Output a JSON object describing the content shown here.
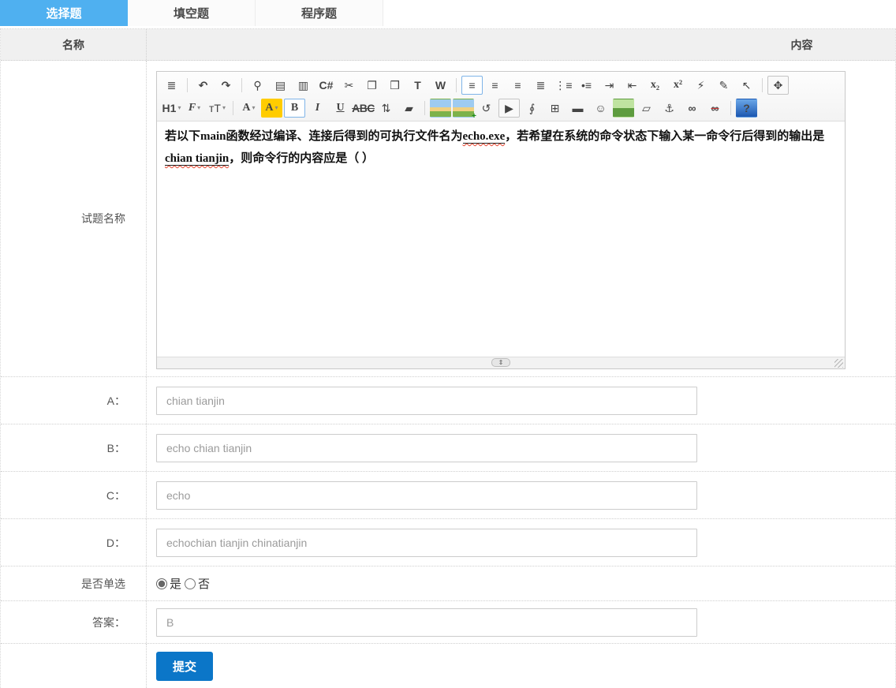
{
  "colors": {
    "accent_tab_blue": "#4FB0F0",
    "submit_button_blue": "#0B76C8",
    "toolbar_icon_blue": "#2b65c0",
    "highlight_yellow": "#FFCC00",
    "spellcheck_red": "#e8442e"
  },
  "tabs": [
    {
      "label": "选择题",
      "active": true
    },
    {
      "label": "填空题",
      "active": false
    },
    {
      "label": "程序题",
      "active": false
    }
  ],
  "table": {
    "header": {
      "name": "名称",
      "content": "内容"
    }
  },
  "question": {
    "label": "试题名称"
  },
  "editor": {
    "statusbar_handle": "⇕",
    "content_segments": [
      {
        "text": "若以下main函数经过编译、连接后得到的可执行文件名为",
        "cls": "seg"
      },
      {
        "text": "echo.exe",
        "cls": "seg uw"
      },
      {
        "text": "，若希望在系统的命令状态下输入某一命令行后得到的输出是",
        "cls": "seg"
      },
      {
        "text": "chian tianjin",
        "cls": "seg uw"
      },
      {
        "text": "，则命令行的内容应是（ ）",
        "cls": "seg"
      }
    ],
    "toolbar": {
      "row1": [
        {
          "n": "source-icon",
          "g": "≣",
          "cls": "ic c-dark",
          "i": "true"
        },
        {
          "n": "separator",
          "g": "",
          "cls": "sep",
          "i": "false"
        },
        {
          "n": "undo-icon",
          "g": "↶",
          "cls": "ic c-blue bld",
          "i": "true"
        },
        {
          "n": "redo-icon",
          "g": "↷",
          "cls": "ic c-blue bld",
          "i": "true"
        },
        {
          "n": "separator",
          "g": "",
          "cls": "sep",
          "i": "false"
        },
        {
          "n": "preview-icon",
          "g": "⚲",
          "cls": "ic c-gray",
          "i": "true"
        },
        {
          "n": "print-icon",
          "g": "▤",
          "cls": "ic c-gray",
          "i": "true"
        },
        {
          "n": "template-icon",
          "g": "▥",
          "cls": "ic c-orange",
          "i": "true"
        },
        {
          "n": "code-icon",
          "g": "C#",
          "cls": "ic c-slate sm bld",
          "i": "true"
        },
        {
          "n": "cut-icon",
          "g": "✂",
          "cls": "ic c-dark",
          "i": "true"
        },
        {
          "n": "copy-icon",
          "g": "❐",
          "cls": "ic c-blue",
          "i": "true"
        },
        {
          "n": "paste-icon",
          "g": "❒",
          "cls": "ic c-tan",
          "i": "true"
        },
        {
          "n": "paste-as-text-icon",
          "g": "T",
          "cls": "ic c-navy bld sm",
          "i": "true"
        },
        {
          "n": "paste-from-word-icon",
          "g": "W",
          "cls": "ic c-navy bld sm",
          "i": "true"
        },
        {
          "n": "separator",
          "g": "",
          "cls": "sep",
          "i": "false"
        },
        {
          "n": "align-left-icon",
          "g": "≡",
          "cls": "ic c-dark sel",
          "i": "true"
        },
        {
          "n": "align-center-icon",
          "g": "≡",
          "cls": "ic c-dark",
          "i": "true"
        },
        {
          "n": "align-right-icon",
          "g": "≡",
          "cls": "ic c-dark",
          "i": "true"
        },
        {
          "n": "align-justify-icon",
          "g": "≣",
          "cls": "ic c-dark",
          "i": "true"
        },
        {
          "n": "ordered-list-icon",
          "g": "⋮≡",
          "cls": "ic c-dark sm",
          "i": "true"
        },
        {
          "n": "unordered-list-icon",
          "g": "•≡",
          "cls": "ic c-dark sm",
          "i": "true"
        },
        {
          "n": "indent-icon",
          "g": "⇥",
          "cls": "ic c-blue",
          "i": "true"
        },
        {
          "n": "outdent-icon",
          "g": "⇤",
          "cls": "ic c-blue",
          "i": "true"
        },
        {
          "n": "subscript-icon",
          "g": "x₂",
          "cls": "ic c-dark sm srf bld",
          "i": "true"
        },
        {
          "n": "superscript-icon",
          "g": "x²",
          "cls": "ic c-dark sm srf bld",
          "i": "true"
        },
        {
          "n": "clear-html-icon",
          "g": "⚡",
          "cls": "ic c-gold",
          "i": "true"
        },
        {
          "n": "quick-format-icon",
          "g": "✎",
          "cls": "ic c-orange",
          "i": "true"
        },
        {
          "n": "select-all-icon",
          "g": "↖",
          "cls": "ic c-dark",
          "i": "true"
        },
        {
          "n": "separator",
          "g": "",
          "cls": "sep",
          "i": "false"
        },
        {
          "n": "fullscreen-icon",
          "g": "✥",
          "cls": "ic c-red frame sm",
          "i": "true"
        }
      ],
      "row2": [
        {
          "n": "heading-select",
          "g": "H1",
          "cls": "ic c-dark bld dd",
          "i": "true"
        },
        {
          "n": "font-name-select",
          "g": "F",
          "cls": "ic c-dark srf it bld dd",
          "i": "true"
        },
        {
          "n": "font-size-select",
          "g": "ᴛT",
          "cls": "ic c-dark dd",
          "i": "true"
        },
        {
          "n": "separator",
          "g": "",
          "cls": "sep",
          "i": "false"
        },
        {
          "n": "text-color-icon",
          "g": "A",
          "cls": "ic c-blue srf bld dd",
          "i": "true"
        },
        {
          "n": "highlight-color-icon",
          "g": "A",
          "cls": "ic hl srf dd",
          "i": "true"
        },
        {
          "n": "bold-icon",
          "g": "B",
          "cls": "ic c-dark srf bld sel",
          "i": "true"
        },
        {
          "n": "italic-icon",
          "g": "I",
          "cls": "ic c-dark srf it bld",
          "i": "true"
        },
        {
          "n": "underline-icon",
          "g": "U",
          "cls": "ic c-dark srf bld ul",
          "i": "true"
        },
        {
          "n": "strikethrough-icon",
          "g": "ABC",
          "cls": "ic c-dark xs bld strike",
          "i": "true"
        },
        {
          "n": "line-height-icon",
          "g": "⇅",
          "cls": "ic c-dark",
          "i": "true"
        },
        {
          "n": "remove-format-icon",
          "g": "▰",
          "cls": "ic c-lightgray",
          "i": "true"
        },
        {
          "n": "separator",
          "g": "",
          "cls": "sep",
          "i": "false"
        },
        {
          "n": "image-icon",
          "g": "",
          "cls": "ic pic",
          "i": "true"
        },
        {
          "n": "multi-image-icon",
          "g": "",
          "cls": "ic pic plus",
          "i": "true"
        },
        {
          "n": "flash-icon",
          "g": "↺",
          "cls": "ic c-slate",
          "i": "true"
        },
        {
          "n": "media-icon",
          "g": "▶",
          "cls": "ic c-gray frame sm",
          "i": "true"
        },
        {
          "n": "attachment-icon",
          "g": "∮",
          "cls": "ic c-gray",
          "i": "true"
        },
        {
          "n": "table-icon",
          "g": "⊞",
          "cls": "ic c-blue",
          "i": "true"
        },
        {
          "n": "horizontal-rule-icon",
          "g": "▬",
          "cls": "ic c-gold",
          "i": "true"
        },
        {
          "n": "emoticon-icon",
          "g": "☺",
          "cls": "ic c-amber",
          "i": "true"
        },
        {
          "n": "map-icon",
          "g": "",
          "cls": "ic pic map",
          "i": "true"
        },
        {
          "n": "page-break-icon",
          "g": "▱",
          "cls": "ic c-gray",
          "i": "true"
        },
        {
          "n": "anchor-icon",
          "g": "⚓",
          "cls": "ic c-slate",
          "i": "true"
        },
        {
          "n": "link-icon",
          "g": "∞",
          "cls": "ic c-blue bld",
          "i": "true"
        },
        {
          "n": "unlink-icon",
          "g": "∞",
          "cls": "ic c-lightgray bld strike-red",
          "i": "true"
        },
        {
          "n": "separator",
          "g": "",
          "cls": "sep",
          "i": "false"
        },
        {
          "n": "about-icon",
          "g": "?",
          "cls": "ic qball",
          "i": "true"
        }
      ]
    }
  },
  "options": [
    {
      "label": "A：",
      "value": "chian tianjin"
    },
    {
      "label": "B：",
      "value": "echo chian tianjin"
    },
    {
      "label": "C：",
      "value": "echo"
    },
    {
      "label": "D：",
      "value": "echochian tianjin chinatianjin"
    }
  ],
  "single_choice": {
    "label": "是否单选",
    "yes": "是",
    "no": "否",
    "selected": "是"
  },
  "answer": {
    "label": "答案：",
    "value": "B"
  },
  "submit_label": "提交"
}
